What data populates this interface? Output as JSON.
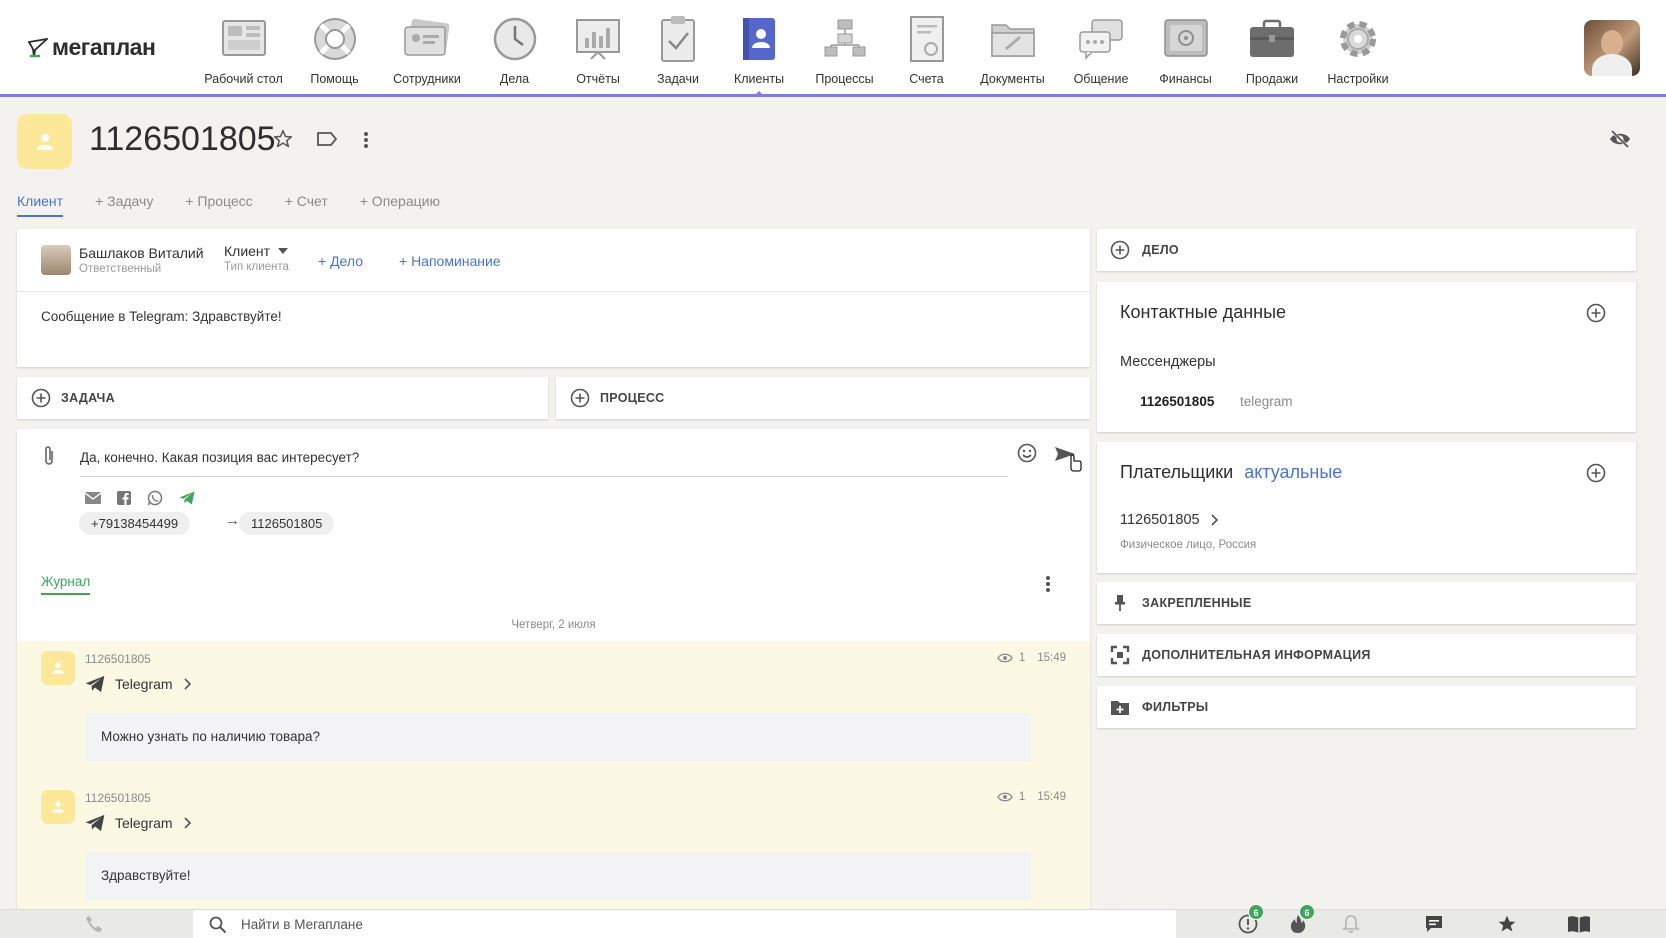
{
  "app": {
    "logo_text": "мегаплан"
  },
  "nav": [
    {
      "label": "Рабочий стол",
      "icon": "desktop-icon"
    },
    {
      "label": "Помощь",
      "icon": "lifebuoy-icon"
    },
    {
      "label": "Сотрудники",
      "icon": "employees-icon"
    },
    {
      "label": "Дела",
      "icon": "clock-icon"
    },
    {
      "label": "Отчёты",
      "icon": "reports-icon"
    },
    {
      "label": "Задачи",
      "icon": "clipboard-icon"
    },
    {
      "label": "Клиенты",
      "icon": "contacts-book-icon",
      "active": true
    },
    {
      "label": "Процессы",
      "icon": "processes-icon"
    },
    {
      "label": "Счета",
      "icon": "invoice-icon"
    },
    {
      "label": "Документы",
      "icon": "folder-icon"
    },
    {
      "label": "Общение",
      "icon": "chat-icon"
    },
    {
      "label": "Финансы",
      "icon": "safe-icon"
    },
    {
      "label": "Продажи",
      "icon": "briefcase-icon"
    },
    {
      "label": "Настройки",
      "icon": "gear-icon"
    }
  ],
  "page": {
    "title": "1126501805"
  },
  "tabs": [
    {
      "label": "Клиент",
      "active": true
    },
    {
      "label": "+ Задачу"
    },
    {
      "label": "+ Процесс"
    },
    {
      "label": "+ Счет"
    },
    {
      "label": "+ Операцию"
    }
  ],
  "client_card": {
    "responsible_name": "Башлаков Виталий",
    "responsible_label": "Ответственный",
    "client_type_value": "Клиент",
    "client_type_label": "Тип клиента",
    "add_case": "+ Дело",
    "add_reminder": "+ Напоминание",
    "last_message": "Сообщение в Telegram: Здравствуйте!"
  },
  "quick_add": {
    "task": "ЗАДАЧА",
    "process": "ПРОЦЕСС"
  },
  "composer": {
    "text": "Да, конечно. Какая позиция вас интересует?",
    "from_phone": "+79138454499",
    "arrow": "→",
    "to_id": "1126501805"
  },
  "journal": {
    "tab_label": "Журнал",
    "date_label": "Четверг, 2 июля",
    "entries": [
      {
        "from": "1126501805",
        "views": "1",
        "time": "15:49",
        "channel": "Telegram",
        "text": "Можно узнать по наличию товара?"
      },
      {
        "from": "1126501805",
        "views": "1",
        "time": "15:49",
        "channel": "Telegram",
        "text": "Здравствуйте!"
      }
    ]
  },
  "right": {
    "case_label": "ДЕЛО",
    "contacts_title": "Контактные данные",
    "messengers_label": "Мессенджеры",
    "messenger_id": "1126501805",
    "messenger_type": "telegram",
    "payers_title": "Плательщики",
    "payers_filter": "актуальные",
    "payer_name": "1126501805",
    "payer_sub": "Физическое лицо, Россия",
    "pinned_label": "ЗАКРЕПЛЕННЫЕ",
    "extra_label": "ДОПОЛНИТЕЛЬНАЯ ИНФОРМАЦИЯ",
    "filters_label": "ФИЛЬТРЫ"
  },
  "bottombar": {
    "search_placeholder": "Найти в Мегаплане",
    "alerts_count": "6",
    "hot_count": "6"
  },
  "colors": {
    "accent_blue": "#4a76c9",
    "nav_underline": "#7b7fd6",
    "green": "#3ea65a",
    "avatar_yellow": "#fde89a",
    "entry_bg": "#fbf8e3"
  }
}
